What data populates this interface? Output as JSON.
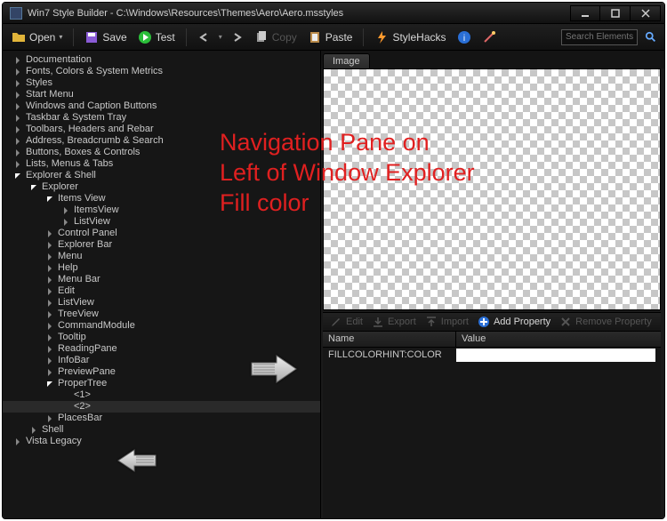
{
  "title": "Win7 Style Builder - C:\\Windows\\Resources\\Themes\\Aero\\Aero.msstyles",
  "toolbar": {
    "open": "Open",
    "save": "Save",
    "test": "Test",
    "copy": "Copy",
    "paste": "Paste",
    "stylehacks": "StyleHacks"
  },
  "search": {
    "placeholder": "Search Elements"
  },
  "tree": [
    {
      "label": "Documentation",
      "level": 0,
      "expanded": false
    },
    {
      "label": "Fonts, Colors & System Metrics",
      "level": 0,
      "expanded": false
    },
    {
      "label": "Styles",
      "level": 0,
      "expanded": false
    },
    {
      "label": "Start Menu",
      "level": 0,
      "expanded": false
    },
    {
      "label": "Windows and Caption Buttons",
      "level": 0,
      "expanded": false
    },
    {
      "label": "Taskbar & System Tray",
      "level": 0,
      "expanded": false
    },
    {
      "label": "Toolbars, Headers and Rebar",
      "level": 0,
      "expanded": false
    },
    {
      "label": "Address, Breadcrumb & Search",
      "level": 0,
      "expanded": false
    },
    {
      "label": "Buttons, Boxes & Controls",
      "level": 0,
      "expanded": false
    },
    {
      "label": "Lists, Menus & Tabs",
      "level": 0,
      "expanded": false
    },
    {
      "label": "Explorer & Shell",
      "level": 0,
      "expanded": true
    },
    {
      "label": "Explorer",
      "level": 1,
      "expanded": true
    },
    {
      "label": "Items View",
      "level": 2,
      "expanded": true
    },
    {
      "label": "ItemsView",
      "level": 3,
      "expanded": false
    },
    {
      "label": "ListView",
      "level": 3,
      "expanded": false
    },
    {
      "label": "Control Panel",
      "level": 2,
      "expanded": false
    },
    {
      "label": "Explorer Bar",
      "level": 2,
      "expanded": false
    },
    {
      "label": "Menu",
      "level": 2,
      "expanded": false
    },
    {
      "label": "Help",
      "level": 2,
      "expanded": false
    },
    {
      "label": "Menu Bar",
      "level": 2,
      "expanded": false
    },
    {
      "label": "Edit",
      "level": 2,
      "expanded": false
    },
    {
      "label": "ListView",
      "level": 2,
      "expanded": false
    },
    {
      "label": "TreeView",
      "level": 2,
      "expanded": false
    },
    {
      "label": "CommandModule",
      "level": 2,
      "expanded": false
    },
    {
      "label": "Tooltip",
      "level": 2,
      "expanded": false
    },
    {
      "label": "ReadingPane",
      "level": 2,
      "expanded": false
    },
    {
      "label": "InfoBar",
      "level": 2,
      "expanded": false
    },
    {
      "label": "PreviewPane",
      "level": 2,
      "expanded": false
    },
    {
      "label": "ProperTree",
      "level": 2,
      "expanded": true
    },
    {
      "label": "<1>",
      "level": 3,
      "leaf": true
    },
    {
      "label": "<2>",
      "level": 3,
      "leaf": true,
      "selected": true
    },
    {
      "label": "PlacesBar",
      "level": 2,
      "expanded": false
    },
    {
      "label": "Shell",
      "level": 1,
      "expanded": false
    },
    {
      "label": "Vista Legacy",
      "level": 0,
      "expanded": false
    }
  ],
  "image_tab": "Image",
  "prop_toolbar": {
    "edit": "Edit",
    "export": "Export",
    "import": "Import",
    "add": "Add Property",
    "remove": "Remove Property"
  },
  "prop_head": {
    "name": "Name",
    "value": "Value"
  },
  "prop_row": {
    "name": "FILLCOLORHINT:COLOR",
    "value": ""
  },
  "annotation": {
    "line1": "Navigation Pane on",
    "line2": "Left of Window Explorer",
    "line3": "Fill color"
  }
}
